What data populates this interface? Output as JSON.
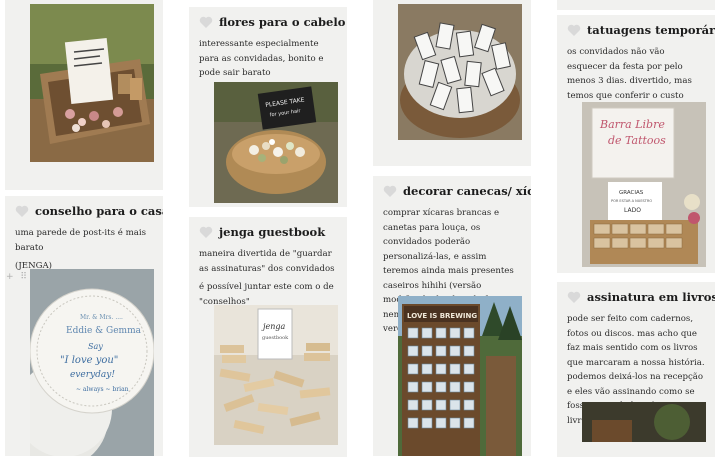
{
  "cards": {
    "flores": {
      "title": "flores para o cabelo",
      "desc": "interessante especialmente para as convidadas, bonito e pode sair barato",
      "sign_lines": [
        "PLEASE TAKE",
        "for your hair"
      ]
    },
    "conselho": {
      "title": "conselho para o casal",
      "desc": "uma parede de post-its é mais barato",
      "note": "(JENGA)",
      "coaster_lines": [
        "Mr. & Mrs. ....",
        "Eddie & Gemma",
        "Say",
        "\"I love you\"",
        "everyday!",
        "~ always ~ brian"
      ]
    },
    "jenga": {
      "title": "jenga guestbook",
      "desc": "maneira divertida de \"guardar as assinaturas\" dos convidados",
      "desc2": "é possível juntar este com o de \"conselhos\"",
      "sign_lines": [
        "jenga",
        "guestbook"
      ]
    },
    "canecas": {
      "title": "decorar canecas/ xícaras",
      "desc": "comprar xícaras brancas e canetas para louça, os convidados poderão personalizá-las, e assim teremos ainda mais presentes caseiros hihihi (versão modificada da ideia da foto. nem sei o que é na foto, na verdade)",
      "sign_lines": [
        "LOVE IS BREWING"
      ]
    },
    "tatuagens": {
      "title": "tatuagens temporárias",
      "desc": "os convidados não vão esquecer da festa por pelo menos 3 dias. divertido, mas temos que conferir o custo",
      "sign_lines": [
        "Barra Libre",
        "de Tattoos",
        "GRACIAS",
        "POR ESTAR A NUESTRO",
        "LADO"
      ]
    },
    "livros": {
      "title": "assinatura em livros",
      "desc": "pode ser feito com cadernos, fotos ou discos. mas acho que faz mais sentido com os livros que marcaram a nossa história. podemos deixá-los na recepção e eles vão assinando como se fosse uma \"dedicatória no livro\""
    }
  },
  "editor": {
    "add_icon": "+",
    "drag_icon": "⠿"
  },
  "colors": {
    "card_bg": "#f1f1ef",
    "heart": "#d9d9d9",
    "page_bg": "#ffffff"
  }
}
